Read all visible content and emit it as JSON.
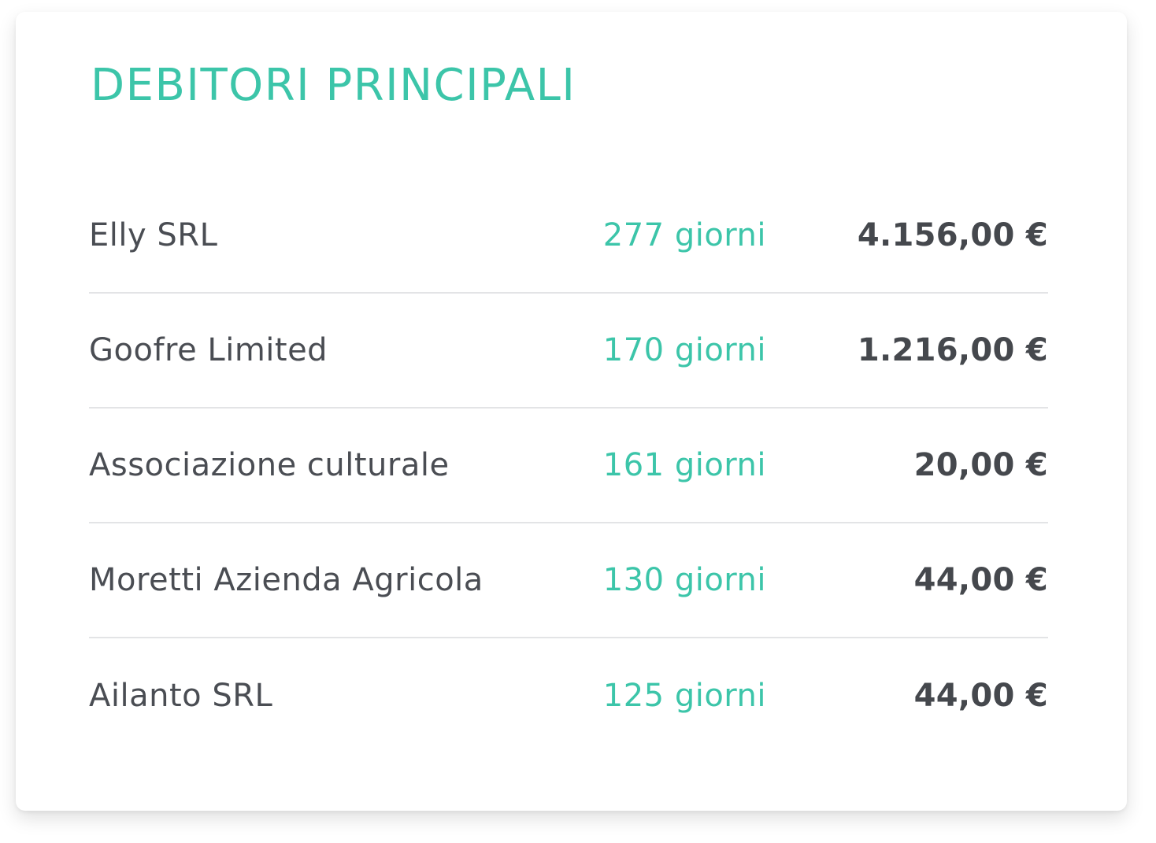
{
  "colors": {
    "accent": "#3cc5a9",
    "text": "#4a4d53",
    "divider": "#e3e4e6",
    "background": "#ffffff"
  },
  "widget": {
    "title": "DEBITORI PRINCIPALI",
    "debtors": [
      {
        "name": "Elly SRL",
        "days": "277 giorni",
        "amount": "4.156,00 €"
      },
      {
        "name": "Goofre Limited",
        "days": "170 giorni",
        "amount": "1.216,00 €"
      },
      {
        "name": "Associazione culturale",
        "days": "161 giorni",
        "amount": "20,00 €"
      },
      {
        "name": "Moretti Azienda Agricola",
        "days": "130 giorni",
        "amount": "44,00 €"
      },
      {
        "name": "Ailanto SRL",
        "days": "125 giorni",
        "amount": "44,00 €"
      }
    ]
  }
}
